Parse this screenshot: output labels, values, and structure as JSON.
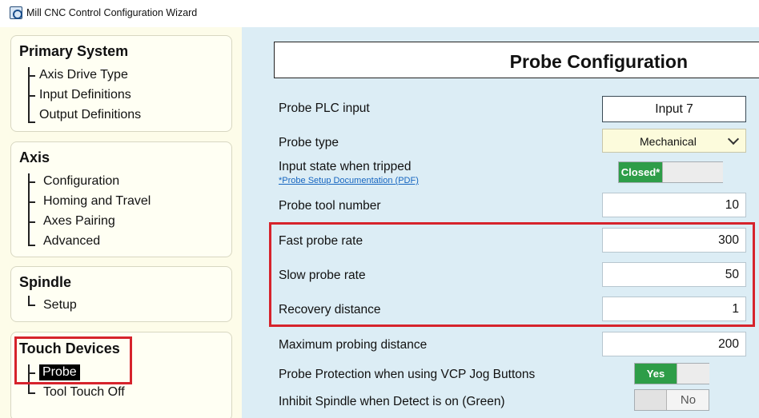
{
  "window": {
    "title": "Mill CNC Control Configuration Wizard"
  },
  "sidebar": {
    "groups": [
      {
        "title": "Primary System",
        "items": [
          "Axis Drive Type",
          "Input Definitions",
          "Output Definitions"
        ]
      },
      {
        "title": "Axis",
        "items": [
          "Configuration",
          "Homing and Travel",
          "Axes Pairing",
          "Advanced"
        ]
      },
      {
        "title": "Spindle",
        "items": [
          "Setup"
        ]
      },
      {
        "title": "Touch Devices",
        "items": [
          "Probe",
          "Tool Touch Off"
        ],
        "selected": "Probe"
      }
    ]
  },
  "main": {
    "header": "Probe Configuration",
    "probe_plc_input": {
      "label": "Probe PLC input",
      "value": "Input 7"
    },
    "probe_type": {
      "label": "Probe type",
      "value": "Mechanical"
    },
    "input_state": {
      "label": "Input state when tripped",
      "toggle_on_label": "Closed*",
      "link": "*Probe Setup Documentation (PDF)"
    },
    "probe_tool_number": {
      "label": "Probe tool number",
      "value": "10"
    },
    "fast_probe_rate": {
      "label": "Fast probe rate",
      "value": "300"
    },
    "slow_probe_rate": {
      "label": "Slow probe rate",
      "value": "50"
    },
    "recovery_distance": {
      "label": "Recovery distance",
      "value": "1"
    },
    "max_probing_distance": {
      "label": "Maximum probing distance",
      "value": "200"
    },
    "probe_protection": {
      "label": "Probe Protection when using VCP Jog Buttons",
      "toggle_label": "Yes",
      "state": "on"
    },
    "inhibit_spindle": {
      "label": "Inhibit Spindle when Detect is on (Green)",
      "toggle_label": "No",
      "state": "off"
    }
  },
  "colors": {
    "toggle_on": "#2e9d48",
    "highlight": "#d6232c",
    "main_bg": "#dcedf5",
    "sidebar_bg": "#fdfce9"
  }
}
